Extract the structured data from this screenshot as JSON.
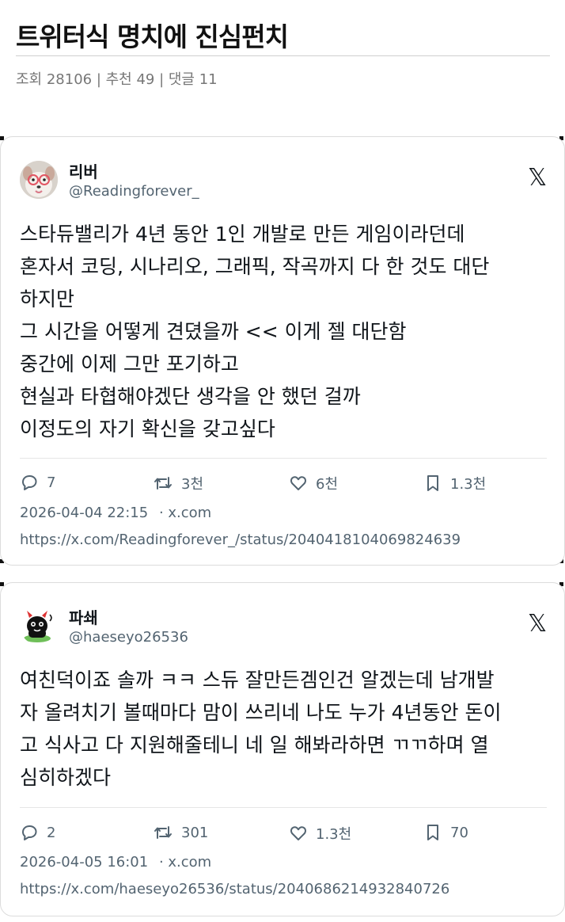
{
  "article": {
    "title": "트위터식 명치에 진심펀치",
    "meta": "조회 28106 | 추천 49 | 댓글 11"
  },
  "tweets": [
    {
      "name": "리버",
      "handle": "@Readingforever_",
      "lines": [
        "스타듀밸리가 4년 동안 1인 개발로 만든 게임이라던데",
        "혼자서 코딩, 시나리오, 그래픽, 작곡까지 다 한 것도 대단",
        "하지만",
        "그 시간을 어떻게 견뎠을까 << 이게 젤 대단함",
        "중간에 이제 그만 포기하고",
        "현실과 타협해야겠단 생각을 안 했던 걸까",
        "이정도의 자기 확신을 갖고싶다"
      ],
      "replies": "7",
      "retweets": "3천",
      "likes": "6천",
      "bookmarks": "1.3천",
      "date": "2026-04-04 22:15",
      "source": "· x.com",
      "url": "https://x.com/Readingforever_/status/2040418104069824639"
    },
    {
      "name": "파쇄",
      "handle": "@haeseyo26536",
      "lines": [
        "여친덕이죠 솔까 ㅋㅋ 스듀 잘만든겜인건 알겠는데 남개발",
        "자 올려치기 볼때마다 맘이 쓰리네 나도 누가 4년동안 돈이",
        "고 식사고 다 지원해줄테니 네 일 해봐라하면 ㄲㄲ하며 열",
        "심히하겠다"
      ],
      "replies": "2",
      "retweets": "301",
      "likes": "1.3천",
      "bookmarks": "70",
      "date": "2026-04-05 16:01",
      "source": "· x.com",
      "url": "https://x.com/haeseyo26536/status/2040686214932840726"
    }
  ],
  "icons": {
    "x_logo": "𝕏",
    "reply": "reply-icon",
    "retweet": "retweet-icon",
    "like": "heart-icon",
    "bookmark": "bookmark-icon"
  }
}
